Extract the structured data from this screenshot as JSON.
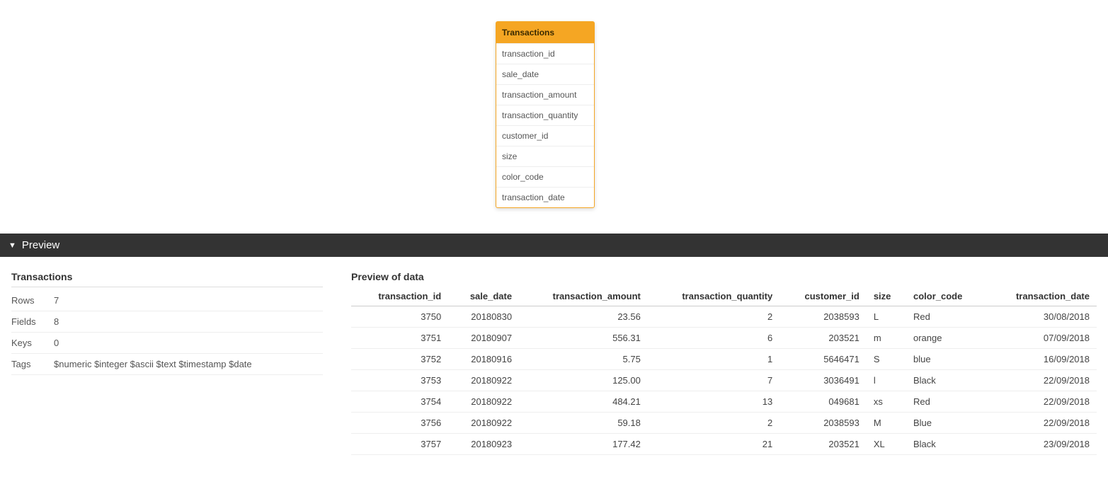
{
  "canvas": {
    "table_card": {
      "title": "Transactions",
      "fields": [
        "transaction_id",
        "sale_date",
        "transaction_amount",
        "transaction_quantity",
        "customer_id",
        "size",
        "color_code",
        "transaction_date"
      ]
    }
  },
  "preview_section": {
    "header": "Preview"
  },
  "meta": {
    "title": "Transactions",
    "rows": [
      {
        "k": "Rows",
        "v": "7"
      },
      {
        "k": "Fields",
        "v": "8"
      },
      {
        "k": "Keys",
        "v": "0"
      },
      {
        "k": "Tags",
        "v": "$numeric $integer $ascii $text $timestamp $date"
      }
    ]
  },
  "data_preview": {
    "title": "Preview of data",
    "columns": [
      {
        "name": "transaction_id",
        "numeric": true
      },
      {
        "name": "sale_date",
        "numeric": true
      },
      {
        "name": "transaction_amount",
        "numeric": true
      },
      {
        "name": "transaction_quantity",
        "numeric": true
      },
      {
        "name": "customer_id",
        "numeric": true
      },
      {
        "name": "size",
        "numeric": false
      },
      {
        "name": "color_code",
        "numeric": false
      },
      {
        "name": "transaction_date",
        "numeric": true
      }
    ],
    "rows": [
      [
        "3750",
        "20180830",
        "23.56",
        "2",
        "2038593",
        "L",
        "Red",
        "30/08/2018"
      ],
      [
        "3751",
        "20180907",
        "556.31",
        "6",
        "203521",
        "m",
        "orange",
        "07/09/2018"
      ],
      [
        "3752",
        "20180916",
        "5.75",
        "1",
        "5646471",
        "S",
        "blue",
        "16/09/2018"
      ],
      [
        "3753",
        "20180922",
        "125.00",
        "7",
        "3036491",
        "l",
        "Black",
        "22/09/2018"
      ],
      [
        "3754",
        "20180922",
        "484.21",
        "13",
        "049681",
        "xs",
        "Red",
        "22/09/2018"
      ],
      [
        "3756",
        "20180922",
        "59.18",
        "2",
        "2038593",
        "M",
        "Blue",
        "22/09/2018"
      ],
      [
        "3757",
        "20180923",
        "177.42",
        "21",
        "203521",
        "XL",
        "Black",
        "23/09/2018"
      ]
    ]
  }
}
